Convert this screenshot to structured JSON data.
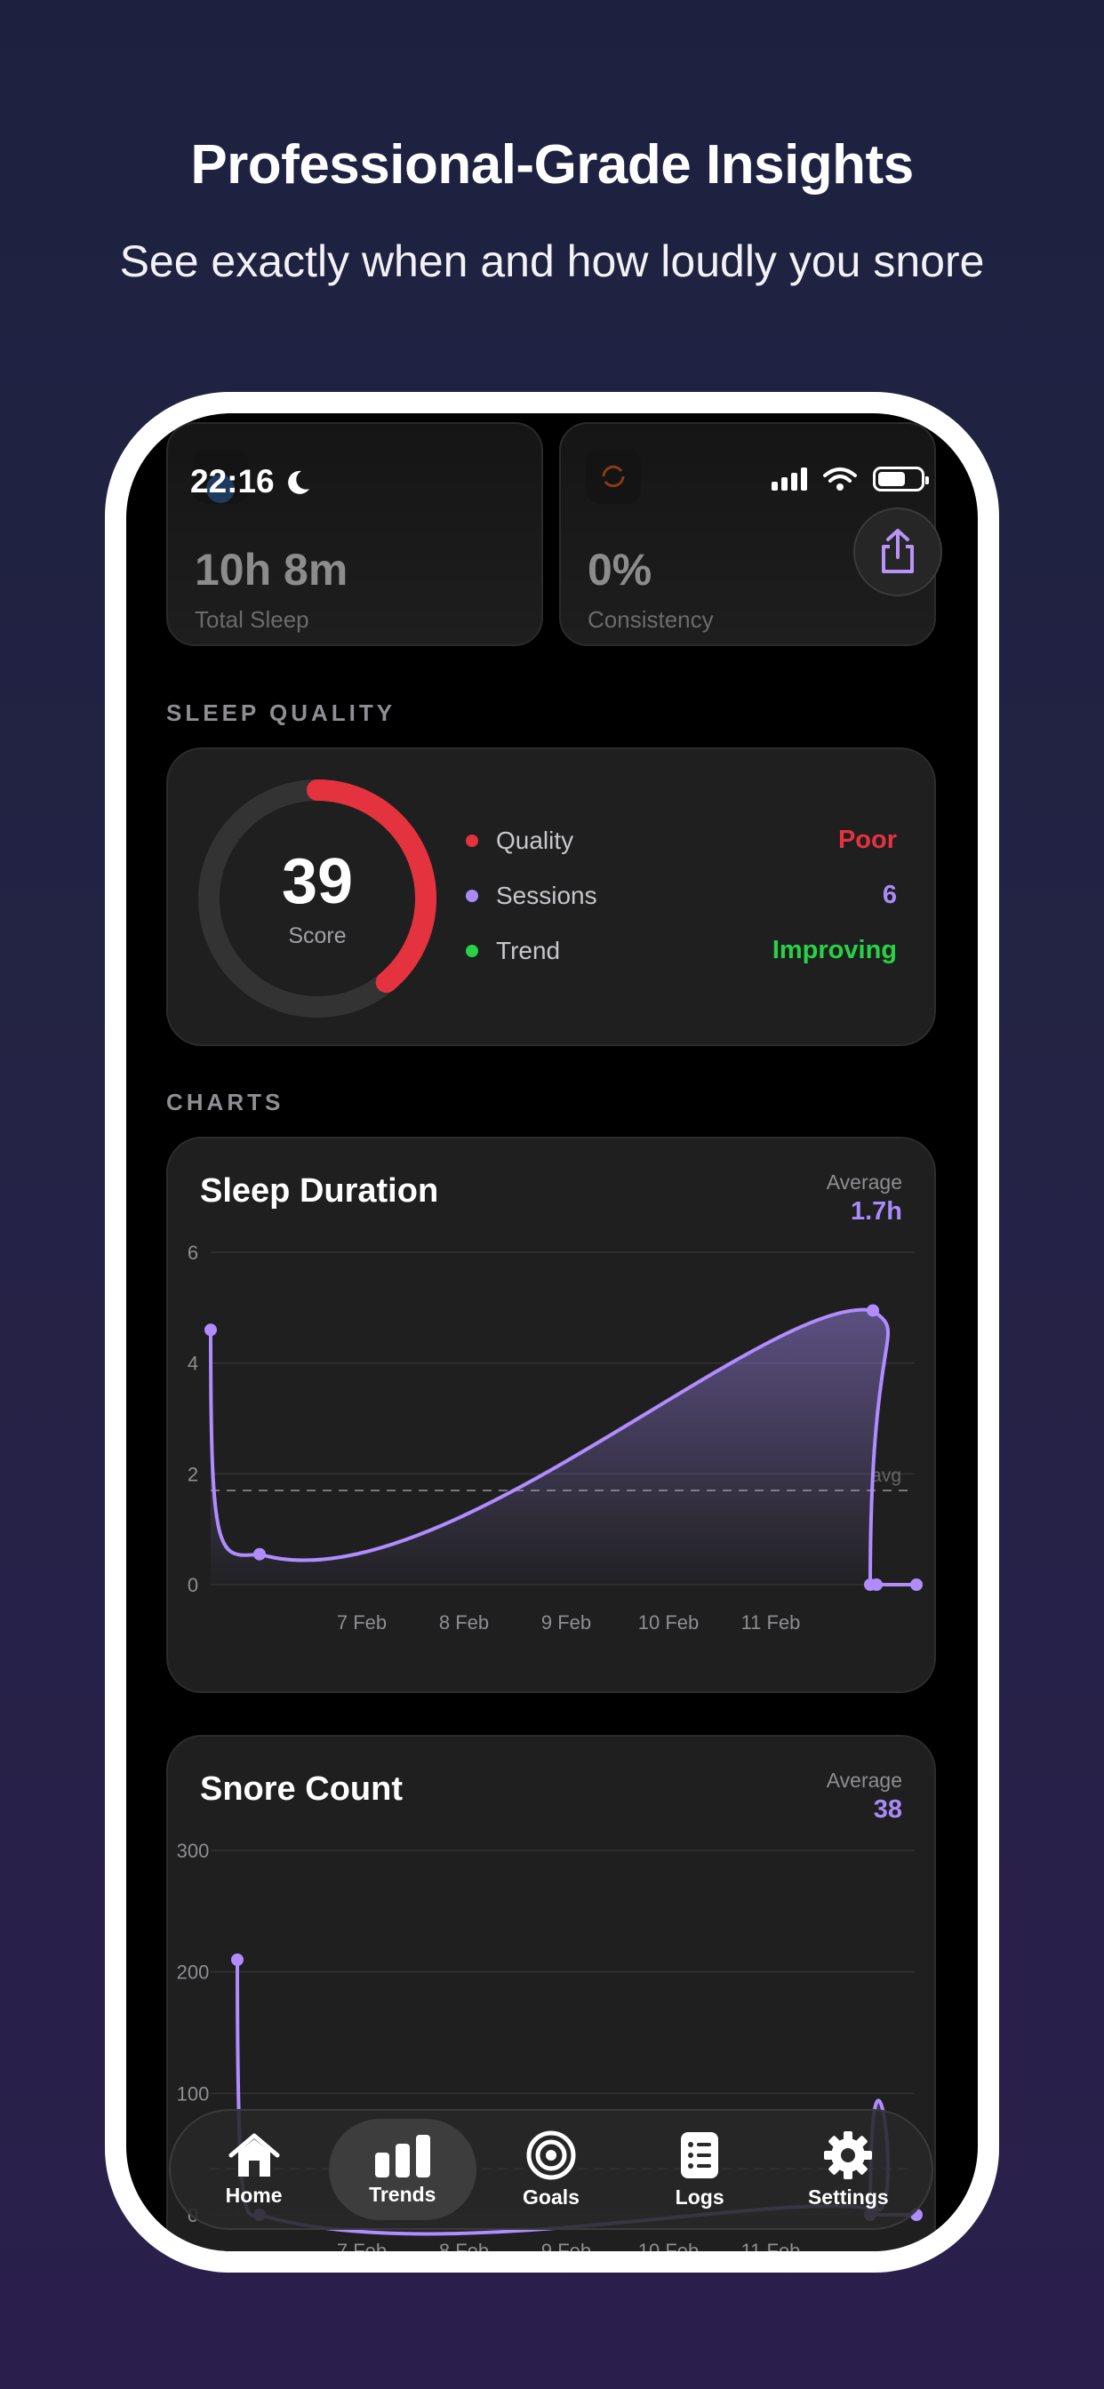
{
  "headline": "Professional-Grade Insights",
  "subheadline": "See exactly when and how loudly you snore",
  "status": {
    "time": "22:16"
  },
  "stats": [
    {
      "value": "10h 8m",
      "label": "Total Sleep"
    },
    {
      "value": "0%",
      "label": "Consistency"
    }
  ],
  "sleep_quality": {
    "section_label": "SLEEP QUALITY",
    "score": "39",
    "score_label": "Score",
    "score_fraction": 0.39,
    "rows": [
      {
        "name": "Quality",
        "value": "Poor",
        "color": "#e5323f"
      },
      {
        "name": "Sessions",
        "value": "6",
        "color": "#a78bfa"
      },
      {
        "name": "Trend",
        "value": "Improving",
        "color": "#28d147"
      }
    ]
  },
  "charts_label": "CHARTS",
  "chart_data": [
    {
      "type": "line",
      "title": "Sleep Duration",
      "average_label": "Average",
      "average_value": "1.7h",
      "average": 1.7,
      "avg_line_label": "avg",
      "ylim": [
        0,
        6
      ],
      "yticks": [
        "0",
        "2",
        "4",
        "6"
      ],
      "xticks": [
        "7 Feb",
        "8 Feb",
        "9 Feb",
        "10 Feb",
        "11 Feb"
      ],
      "points": [
        {
          "x": "5 Feb",
          "y": 4.6
        },
        {
          "x": "6 Feb",
          "y": 0.55
        },
        {
          "x": "12 Feb",
          "y": 4.95
        },
        {
          "x": "13 Feb",
          "y": 0
        },
        {
          "x": "13 Feb",
          "y": 0
        },
        {
          "x": "14 Feb",
          "y": 0
        }
      ]
    },
    {
      "type": "line",
      "title": "Snore Count",
      "average_label": "Average",
      "average_value": "38",
      "average": 38,
      "ylim": [
        0,
        300
      ],
      "yticks": [
        "0",
        "100",
        "200",
        "300"
      ],
      "xticks": [
        "7 Feb",
        "8 Feb",
        "9 Feb",
        "10 Feb",
        "11 Feb"
      ],
      "points": [
        {
          "x": "5 Feb",
          "y": 210
        },
        {
          "x": "6 Feb",
          "y": 0
        },
        {
          "x": "12 Feb",
          "y": 5
        },
        {
          "x": "13 Feb",
          "y": 0
        },
        {
          "x": "14 Feb",
          "y": 0
        }
      ]
    }
  ],
  "tabs": [
    {
      "label": "Home",
      "icon": "house-icon",
      "active": false
    },
    {
      "label": "Trends",
      "icon": "bar-chart-icon",
      "active": true
    },
    {
      "label": "Goals",
      "icon": "target-icon",
      "active": false
    },
    {
      "label": "Logs",
      "icon": "list-icon",
      "active": false
    },
    {
      "label": "Settings",
      "icon": "gear-icon",
      "active": false
    }
  ]
}
